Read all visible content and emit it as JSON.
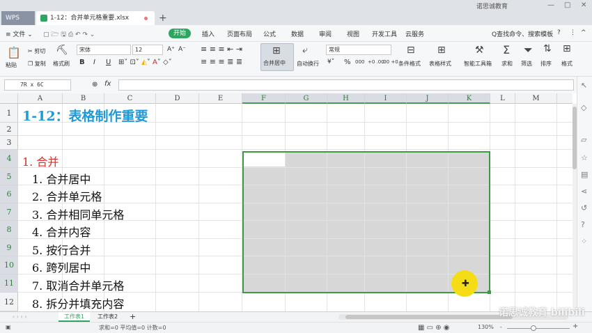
{
  "titlebar": {
    "app_label": "WPS",
    "file_tab": "1-12：合并单元格重要.xlsx",
    "new_tab": "+",
    "brand": "诺思诚教育",
    "min": "—",
    "max": "□",
    "close": "✕"
  },
  "menu": {
    "file": "≡ 文件 ⌄",
    "tabs": [
      "开始",
      "插入",
      "页面布局",
      "公式",
      "数据",
      "审阅",
      "视图",
      "开发工具",
      "云服务"
    ],
    "search": "Q查找命令、搜索模板",
    "help": "?",
    "more": "⋮",
    "collapse": "^"
  },
  "ribbon": {
    "paste": "粘贴",
    "cut": "剪切",
    "copy": "复制",
    "format_painter": "格式刷",
    "font_name": "宋体",
    "font_size": "12",
    "grow": "A⁺",
    "shrink": "A⁻",
    "bold": "B",
    "italic": "I",
    "underline": "U",
    "merge_center": "合并居中",
    "wrap": "自动换行",
    "number_format": "常规",
    "percent": "%",
    "thousands": "000",
    "inc_decimal": "+0 .00",
    "dec_decimal": ".00 +0",
    "cond_format": "条件格式",
    "table_style": "表格样式",
    "smart_tools": "智能工具箱",
    "sum": "求和",
    "filter": "筛选",
    "sort": "排序",
    "format": "格式"
  },
  "formula_bar": {
    "name_box": "7R x 6C",
    "fx": "fx",
    "value": ""
  },
  "columns": [
    "A",
    "B",
    "C",
    "D",
    "E",
    "F",
    "G",
    "H",
    "I",
    "J",
    "K",
    "L",
    "M"
  ],
  "selected_columns": [
    "F",
    "G",
    "H",
    "I",
    "J",
    "K"
  ],
  "rows": [
    "1",
    "2",
    "3",
    "4",
    "5",
    "6",
    "7",
    "8",
    "9",
    "10",
    "11",
    "12"
  ],
  "selected_rows": [
    "4",
    "5",
    "6",
    "7",
    "8",
    "9",
    "10",
    "11"
  ],
  "cells": {
    "title": "1-12：表格制作重要",
    "section": "1. 合并",
    "items": [
      "1. 合并居中",
      "2. 合并单元格",
      "3. 合并相同单元格",
      "4. 合并内容",
      "5. 按行合并",
      "6. 跨列居中",
      "7. 取消合并单元格",
      "8. 拆分并填充内容"
    ]
  },
  "sheets": {
    "tabs": [
      "工作表1",
      "工作表2"
    ],
    "active": "工作表1",
    "add": "+"
  },
  "status": {
    "stats": "求和=0  平均值=0  计数=0",
    "zoom": "130%",
    "zoom_minus": "-",
    "zoom_plus": "+"
  },
  "watermark": "诺思诚教育 bilibili",
  "colors": {
    "accent_green": "#2fa562",
    "title_blue": "#1f9ad6",
    "section_red": "#e02a2a",
    "selection_border": "#3c9a47",
    "cursor_yellow": "#f4dc16"
  }
}
